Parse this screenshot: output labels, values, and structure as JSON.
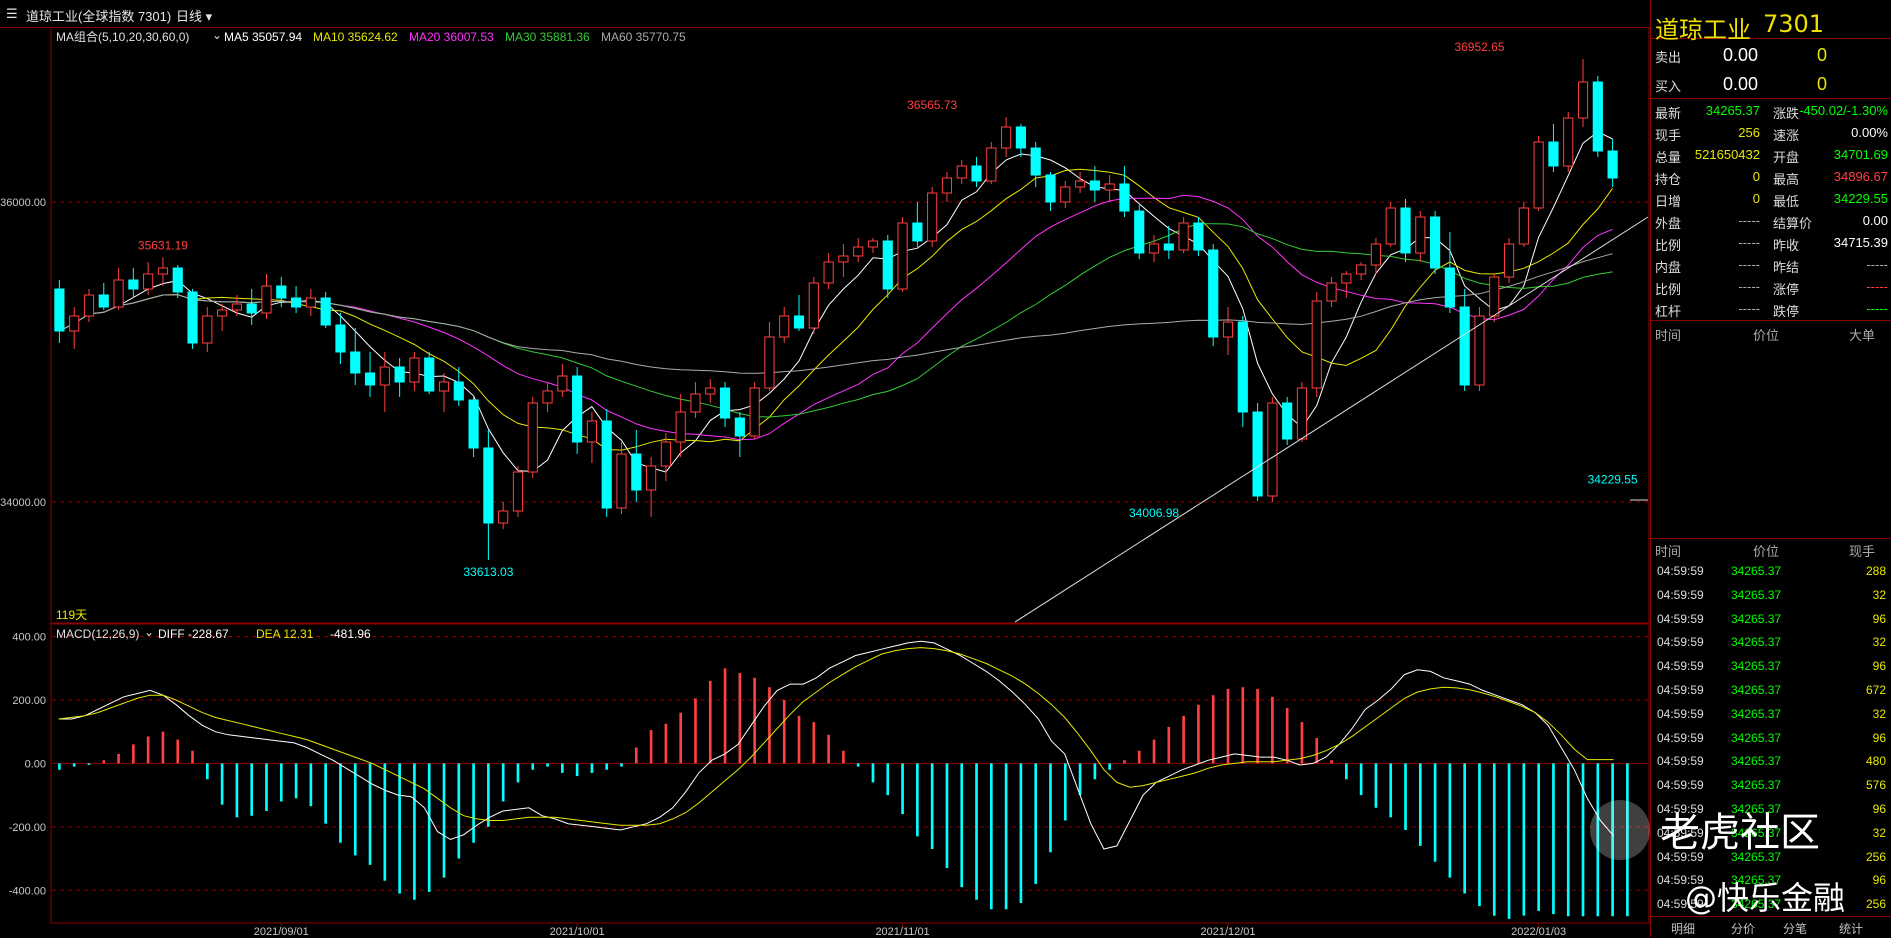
{
  "header": {
    "title": "道琼工业(全球指数 7301)",
    "period": "日线",
    "ma_label": "MA组合(5,10,20,30,60,0)",
    "ma": [
      {
        "name": "MA5",
        "value": "35057.94",
        "color": "#ffffff"
      },
      {
        "name": "MA10",
        "value": "35624.62",
        "color": "#e8e800"
      },
      {
        "name": "MA20",
        "value": "36007.53",
        "color": "#ff33ff"
      },
      {
        "name": "MA30",
        "value": "35881.36",
        "color": "#33cc33"
      },
      {
        "name": "MA60",
        "value": "35770.75",
        "color": "#aaaaaa"
      }
    ]
  },
  "macd": {
    "label": "MACD(12,26,9)",
    "diff": "DIFF -228.67",
    "dea": "DEA 12.31",
    "macd": "-481.96"
  },
  "days_label": "119天",
  "chart_data": {
    "type": "candlestick",
    "price_axis": {
      "ticks": [
        "36000.00",
        "34000.00"
      ],
      "ylim": [
        33200,
        37100
      ]
    },
    "macd_axis": {
      "ticks": [
        "400.00",
        "200.00",
        "0.00",
        "-200.00",
        "-400.00"
      ],
      "ylim": [
        -500,
        430
      ]
    },
    "x_ticks": [
      {
        "label": "2021/09/01",
        "index": 15
      },
      {
        "label": "2021/10/01",
        "index": 35
      },
      {
        "label": "2021/11/01",
        "index": 57
      },
      {
        "label": "2021/12/01",
        "index": 79
      },
      {
        "label": "2022/01/03",
        "index": 100
      }
    ],
    "annotations": [
      {
        "text": "35631.19",
        "index": 7,
        "value": 35631.19,
        "pos": "above"
      },
      {
        "text": "33613.03",
        "index": 29,
        "value": 33613.03,
        "pos": "below"
      },
      {
        "text": "36565.73",
        "index": 59,
        "value": 36565.73,
        "pos": "above"
      },
      {
        "text": "34006.98",
        "index": 74,
        "value": 34006.98,
        "pos": "below"
      },
      {
        "text": "36952.65",
        "index": 96,
        "value": 36952.65,
        "pos": "above"
      },
      {
        "text": "34229.55",
        "index": 105,
        "value": 34229.55,
        "pos": "below"
      }
    ],
    "candles": [
      [
        35420,
        35480,
        35060,
        35140
      ],
      [
        35140,
        35300,
        35020,
        35240
      ],
      [
        35240,
        35420,
        35200,
        35380
      ],
      [
        35380,
        35460,
        35280,
        35300
      ],
      [
        35300,
        35560,
        35280,
        35480
      ],
      [
        35480,
        35560,
        35360,
        35420
      ],
      [
        35420,
        35600,
        35380,
        35520
      ],
      [
        35520,
        35631.19,
        35440,
        35560
      ],
      [
        35560,
        35580,
        35360,
        35400
      ],
      [
        35400,
        35420,
        35020,
        35060
      ],
      [
        35060,
        35300,
        35000,
        35240
      ],
      [
        35240,
        35320,
        35140,
        35280
      ],
      [
        35280,
        35380,
        35240,
        35320
      ],
      [
        35320,
        35420,
        35180,
        35260
      ],
      [
        35260,
        35520,
        35220,
        35440
      ],
      [
        35440,
        35500,
        35300,
        35360
      ],
      [
        35360,
        35440,
        35260,
        35300
      ],
      [
        35300,
        35420,
        35240,
        35360
      ],
      [
        35360,
        35400,
        35160,
        35180
      ],
      [
        35180,
        35260,
        34920,
        35000
      ],
      [
        35000,
        35160,
        34780,
        34860
      ],
      [
        34860,
        35000,
        34700,
        34780
      ],
      [
        34780,
        35000,
        34600,
        34900
      ],
      [
        34900,
        34960,
        34700,
        34800
      ],
      [
        34800,
        35000,
        34740,
        34960
      ],
      [
        34960,
        35000,
        34720,
        34740
      ],
      [
        34740,
        34860,
        34600,
        34800
      ],
      [
        34800,
        34900,
        34640,
        34680
      ],
      [
        34680,
        34700,
        34300,
        34360
      ],
      [
        34360,
        34480,
        33613.03,
        33860
      ],
      [
        33860,
        34000,
        33820,
        33940
      ],
      [
        33940,
        34240,
        33900,
        34200
      ],
      [
        34200,
        34700,
        34160,
        34660
      ],
      [
        34660,
        34800,
        34600,
        34740
      ],
      [
        34740,
        34920,
        34700,
        34840
      ],
      [
        34840,
        34900,
        34320,
        34400
      ],
      [
        34400,
        34600,
        34260,
        34540
      ],
      [
        34540,
        34620,
        33900,
        33960
      ],
      [
        33960,
        34400,
        33920,
        34320
      ],
      [
        34320,
        34480,
        34000,
        34080
      ],
      [
        34080,
        34300,
        33900,
        34240
      ],
      [
        34240,
        34460,
        34140,
        34400
      ],
      [
        34400,
        34720,
        34300,
        34600
      ],
      [
        34600,
        34800,
        34560,
        34720
      ],
      [
        34720,
        34820,
        34660,
        34760
      ],
      [
        34760,
        34800,
        34500,
        34560
      ],
      [
        34560,
        34600,
        34300,
        34440
      ],
      [
        34440,
        34800,
        34420,
        34760
      ],
      [
        34760,
        35200,
        34740,
        35100
      ],
      [
        35100,
        35300,
        35060,
        35240
      ],
      [
        35240,
        35380,
        35140,
        35160
      ],
      [
        35160,
        35500,
        35120,
        35460
      ],
      [
        35460,
        35660,
        35420,
        35600
      ],
      [
        35600,
        35720,
        35500,
        35640
      ],
      [
        35640,
        35760,
        35600,
        35700
      ],
      [
        35700,
        35760,
        35660,
        35740
      ],
      [
        35740,
        35780,
        35360,
        35420
      ],
      [
        35420,
        35900,
        35400,
        35860
      ],
      [
        35860,
        36000,
        35700,
        35740
      ],
      [
        35740,
        36100,
        35700,
        36060
      ],
      [
        36060,
        36200,
        36000,
        36160
      ],
      [
        36160,
        36280,
        36120,
        36240
      ],
      [
        36240,
        36300,
        36100,
        36140
      ],
      [
        36140,
        36400,
        36120,
        36360
      ],
      [
        36360,
        36565.73,
        36300,
        36500
      ],
      [
        36500,
        36520,
        36300,
        36360
      ],
      [
        36360,
        36400,
        36100,
        36180
      ],
      [
        36180,
        36200,
        35940,
        36000
      ],
      [
        36000,
        36140,
        35960,
        36100
      ],
      [
        36100,
        36200,
        36060,
        36140
      ],
      [
        36140,
        36240,
        36000,
        36080
      ],
      [
        36080,
        36180,
        36000,
        36120
      ],
      [
        36120,
        36240,
        35900,
        35940
      ],
      [
        35940,
        35980,
        35620,
        35660
      ],
      [
        35660,
        35780,
        35600,
        35720
      ],
      [
        35720,
        35840,
        35620,
        35680
      ],
      [
        35680,
        35900,
        35660,
        35860
      ],
      [
        35860,
        35900,
        35640,
        35680
      ],
      [
        35680,
        35720,
        35040,
        35100
      ],
      [
        35100,
        35300,
        34980,
        35200
      ],
      [
        35200,
        35240,
        34500,
        34600
      ],
      [
        34600,
        34660,
        34006.98,
        34040
      ],
      [
        34040,
        34700,
        34000,
        34660
      ],
      [
        34660,
        34700,
        34380,
        34420
      ],
      [
        34420,
        34800,
        34400,
        34760
      ],
      [
        34760,
        35400,
        34700,
        35340
      ],
      [
        35340,
        35500,
        35300,
        35460
      ],
      [
        35460,
        35540,
        35360,
        35520
      ],
      [
        35520,
        35600,
        35480,
        35580
      ],
      [
        35580,
        35760,
        35520,
        35720
      ],
      [
        35720,
        36000,
        35700,
        35960
      ],
      [
        35960,
        36020,
        35600,
        35660
      ],
      [
        35660,
        35940,
        35600,
        35900
      ],
      [
        35900,
        35940,
        35520,
        35560
      ],
      [
        35560,
        35800,
        35260,
        35300
      ],
      [
        35300,
        35420,
        34740,
        34780
      ],
      [
        34780,
        35300,
        34740,
        35240
      ],
      [
        35240,
        35520,
        35200,
        35500
      ],
      [
        35500,
        35760,
        35460,
        35720
      ],
      [
        35720,
        36000,
        35700,
        35960
      ],
      [
        35960,
        36440,
        35940,
        36400
      ],
      [
        36400,
        36520,
        36200,
        36240
      ],
      [
        36240,
        36600,
        36200,
        36560
      ],
      [
        36560,
        36952.65,
        36500,
        36800
      ],
      [
        36800,
        36840,
        36300,
        36340
      ],
      [
        36340,
        36420,
        36100,
        36160
      ]
    ],
    "macd_hist": [
      -20,
      -10,
      -5,
      10,
      30,
      60,
      85,
      100,
      75,
      40,
      -50,
      -130,
      -170,
      -165,
      -150,
      -120,
      -110,
      -135,
      -190,
      -250,
      -290,
      -320,
      -370,
      -410,
      -430,
      -405,
      -360,
      -300,
      -250,
      -200,
      -120,
      -60,
      -20,
      -10,
      -30,
      -40,
      -30,
      -20,
      -10,
      50,
      105,
      125,
      160,
      205,
      260,
      300,
      285,
      270,
      240,
      200,
      150,
      130,
      90,
      40,
      -10,
      -60,
      -100,
      -160,
      -230,
      -270,
      -330,
      -390,
      -430,
      -460,
      -460,
      -440,
      -380,
      -280,
      -180,
      -100,
      -50,
      -20,
      10,
      40,
      75,
      115,
      150,
      185,
      215,
      235,
      240,
      235,
      210,
      175,
      130,
      80,
      10,
      -50,
      -100,
      -140,
      -170,
      -210,
      -260,
      -310,
      -360,
      -410,
      -450,
      -480,
      -490,
      -480,
      -465,
      -475,
      -482,
      -482,
      -482,
      -482,
      -482
    ],
    "diff": [
      140,
      140,
      150,
      170,
      190,
      210,
      220,
      230,
      215,
      185,
      150,
      120,
      100,
      90,
      85,
      80,
      75,
      70,
      65,
      50,
      30,
      10,
      -15,
      -40,
      -65,
      -85,
      -100,
      -105,
      -140,
      -215,
      -240,
      -225,
      -195,
      -170,
      -150,
      -145,
      -140,
      -165,
      -175,
      -190,
      -195,
      -200,
      -205,
      -210,
      -200,
      -190,
      -170,
      -140,
      -90,
      -30,
      10,
      30,
      60,
      120,
      180,
      230,
      250,
      250,
      270,
      300,
      320,
      340,
      350,
      360,
      370,
      380,
      385,
      380,
      360,
      340,
      315,
      290,
      260,
      225,
      185,
      140,
      70,
      30,
      -80,
      -190,
      -270,
      -260,
      -180,
      -100,
      -60,
      -40,
      -20,
      -5,
      10,
      20,
      30,
      25,
      20,
      20,
      10,
      -5,
      0,
      20,
      60,
      110,
      170,
      200,
      235,
      280,
      295,
      290,
      270,
      260,
      250,
      230,
      215,
      200,
      185,
      160,
      120,
      50,
      -20,
      -110,
      -180,
      -228
    ],
    "dea": [
      140,
      145,
      150,
      160,
      175,
      190,
      205,
      215,
      215,
      200,
      180,
      160,
      145,
      135,
      125,
      115,
      105,
      95,
      85,
      75,
      60,
      45,
      30,
      15,
      0,
      -20,
      -40,
      -60,
      -80,
      -110,
      -140,
      -165,
      -175,
      -180,
      -180,
      -175,
      -170,
      -170,
      -170,
      -175,
      -180,
      -185,
      -190,
      -195,
      -195,
      -195,
      -190,
      -175,
      -155,
      -125,
      -90,
      -55,
      -20,
      20,
      65,
      110,
      155,
      195,
      225,
      255,
      280,
      305,
      325,
      345,
      355,
      362,
      365,
      362,
      355,
      345,
      330,
      315,
      295,
      275,
      250,
      220,
      185,
      145,
      95,
      40,
      -20,
      -60,
      -75,
      -70,
      -60,
      -50,
      -40,
      -30,
      -15,
      -5,
      0,
      5,
      5,
      5,
      10,
      15,
      25,
      40,
      60,
      85,
      115,
      145,
      175,
      205,
      225,
      235,
      240,
      238,
      232,
      222,
      210,
      195,
      180,
      160,
      130,
      90,
      45,
      12,
      12,
      12
    ]
  },
  "panel": {
    "title": "道琼工业",
    "code": "7301",
    "sell": {
      "label": "卖出",
      "price": "0.00",
      "vol": "0"
    },
    "buy": {
      "label": "买入",
      "price": "0.00",
      "vol": "0"
    },
    "quote": [
      {
        "l1": "最新",
        "v1": "34265.37",
        "c1": "#00ff00",
        "l2": "涨跌",
        "v2": "-450.02/-1.30%",
        "c2": "#00ff00"
      },
      {
        "l1": "现手",
        "v1": "256",
        "c1": "#e8e800",
        "l2": "速涨",
        "v2": "0.00%",
        "c2": "#ffffff"
      },
      {
        "l1": "总量",
        "v1": "521650432",
        "c1": "#e8e800",
        "l2": "开盘",
        "v2": "34701.69",
        "c2": "#00ff00"
      },
      {
        "l1": "持仓",
        "v1": "0",
        "c1": "#e8e800",
        "l2": "最高",
        "v2": "34896.67",
        "c2": "#ff4040"
      },
      {
        "l1": "日增",
        "v1": "0",
        "c1": "#e8e800",
        "l2": "最低",
        "v2": "34229.55",
        "c2": "#00ff00"
      },
      {
        "l1": "外盘",
        "v1": "-----",
        "c1": "#aaaaaa",
        "l2": "结算价",
        "v2": "0.00",
        "c2": "#ffffff"
      },
      {
        "l1": "比例",
        "v1": "-----",
        "c1": "#aaaaaa",
        "l2": "昨收",
        "v2": "34715.39",
        "c2": "#ffffff"
      },
      {
        "l1": "内盘",
        "v1": "-----",
        "c1": "#aaaaaa",
        "l2": "昨结",
        "v2": "-----",
        "c2": "#aaaaaa"
      },
      {
        "l1": "比例",
        "v1": "-----",
        "c1": "#aaaaaa",
        "l2": "涨停",
        "v2": "-----",
        "c2": "#ff4040"
      },
      {
        "l1": "杠杆",
        "v1": "-----",
        "c1": "#aaaaaa",
        "l2": "跌停",
        "v2": "-----",
        "c2": "#00ff00"
      }
    ],
    "upper_header": {
      "time": "时间",
      "price": "价位",
      "vol": "大单"
    },
    "lower_header": {
      "time": "时间",
      "price": "价位",
      "vol": "现手"
    },
    "ticks": [
      {
        "time": "04:59:59",
        "price": "34265.37",
        "vol": "288"
      },
      {
        "time": "04:59:59",
        "price": "34265.37",
        "vol": "32"
      },
      {
        "time": "04:59:59",
        "price": "34265.37",
        "vol": "96"
      },
      {
        "time": "04:59:59",
        "price": "34265.37",
        "vol": "32"
      },
      {
        "time": "04:59:59",
        "price": "34265.37",
        "vol": "96"
      },
      {
        "time": "04:59:59",
        "price": "34265.37",
        "vol": "672"
      },
      {
        "time": "04:59:59",
        "price": "34265.37",
        "vol": "32"
      },
      {
        "time": "04:59:59",
        "price": "34265.37",
        "vol": "96"
      },
      {
        "time": "04:59:59",
        "price": "34265.37",
        "vol": "480"
      },
      {
        "time": "04:59:59",
        "price": "34265.37",
        "vol": "576"
      },
      {
        "time": "04:59:59",
        "price": "34265.37",
        "vol": "96"
      },
      {
        "time": "04:59:59",
        "price": "34265.37",
        "vol": "32"
      },
      {
        "time": "04:59:59",
        "price": "34265.37",
        "vol": "256"
      },
      {
        "time": "04:59:59",
        "price": "34265.37",
        "vol": "96"
      },
      {
        "time": "04:59:59",
        "price": "34265.37",
        "vol": "256"
      }
    ],
    "footer_tabs": [
      "明细",
      "分价",
      "分笔",
      "统计"
    ]
  },
  "watermark": {
    "line1": "老虎社区",
    "line2": "@快乐金融"
  }
}
